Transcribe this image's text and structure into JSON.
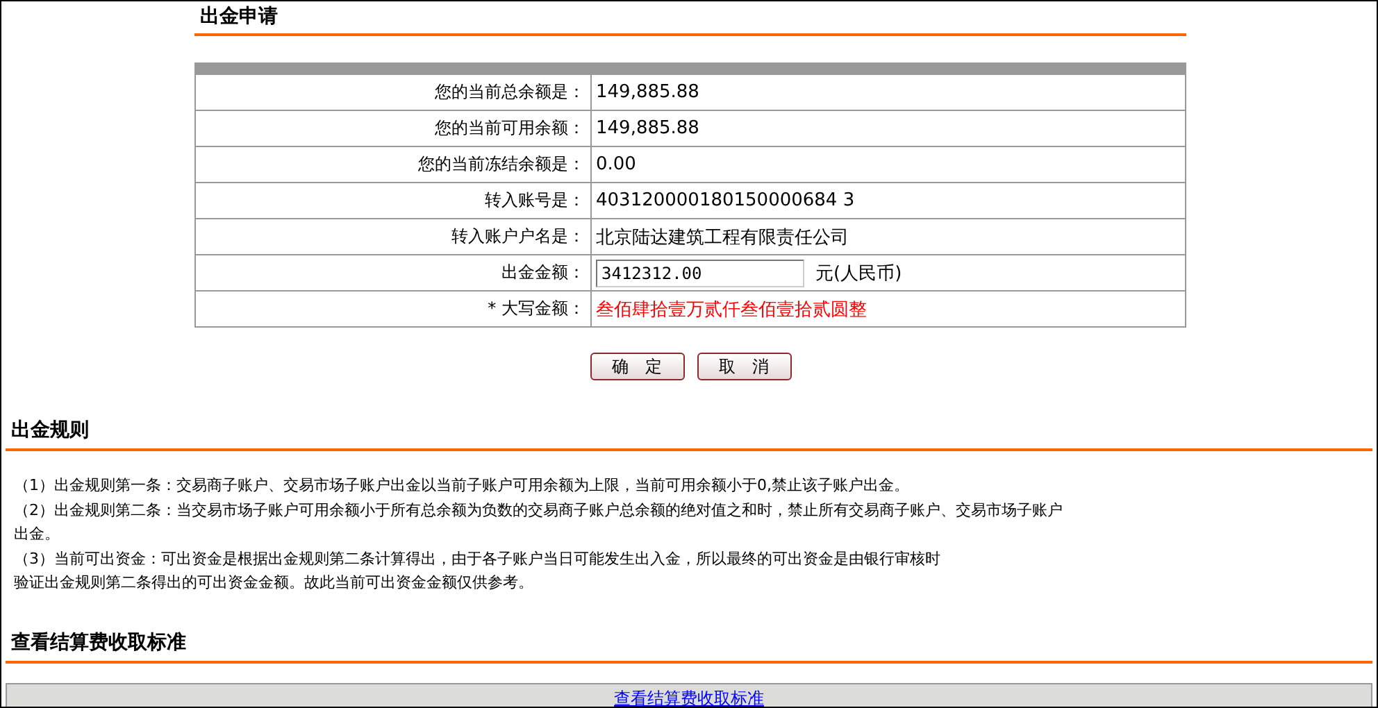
{
  "application": {
    "title": "出金申请",
    "fields": [
      {
        "kind": "text",
        "label": "您的当前总余额是：",
        "value": "149,885.88"
      },
      {
        "kind": "text",
        "label": "您的当前可用余额：",
        "value": "149,885.88"
      },
      {
        "kind": "text",
        "label": "您的当前冻结余额是：",
        "value": "0.00"
      },
      {
        "kind": "text",
        "label": "转入账号是：",
        "value": "403120000180150000684 3"
      },
      {
        "kind": "text",
        "label": "转入账户户名是：",
        "value": "北京陆达建筑工程有限责任公司"
      },
      {
        "kind": "input",
        "label": "出金金额：",
        "value": "3412312.00",
        "unit": "元(人民币)"
      },
      {
        "kind": "alert",
        "label": "* 大写金额：",
        "value": "叁佰肆拾壹万贰仟叁佰壹拾贰圆整"
      }
    ],
    "buttons": [
      "确　定",
      "取　消"
    ]
  },
  "rules": {
    "title": "出金规则",
    "items": [
      {
        "lines": [
          "（1）出金规则第一条：交易商子账户、交易市场子账户出金以当前子账户可用余额为上限，当前可用余额小于0,禁止该子账户出金。"
        ]
      },
      {
        "lines": [
          "（2）出金规则第二条：当交易市场子账户可用余额小于所有总余额为负数的交易商子账户总余额的绝对值之和时，禁止所有交易商子账户、交易市场子账户",
          "出金。"
        ]
      },
      {
        "lines": [
          "（3）当前可出资金：可出资金是根据出金规则第二条计算得出，由于各子账户当日可能发生出入金，所以最终的可出资金是由银行审核时",
          "验证出金规则第二条得出的可出资金金额。故此当前可出资金金额仅供参考。"
        ]
      }
    ]
  },
  "fees": {
    "title": "查看结算费收取标准",
    "link": "查看结算费收取标准"
  }
}
